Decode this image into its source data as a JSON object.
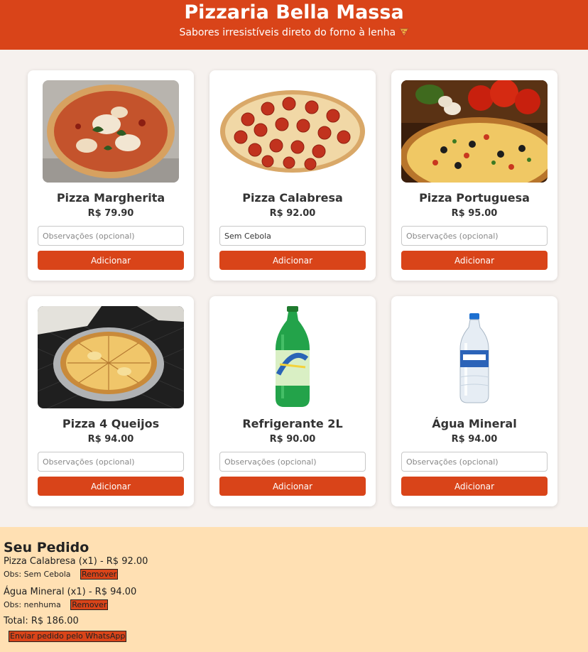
{
  "header": {
    "title": "Pizzaria Bella Massa",
    "subtitle": "Sabores irresistíveis direto do forno à lenha"
  },
  "products": [
    {
      "name": "Pizza Margherita",
      "price": "R$ 79.90",
      "obs_value": "",
      "obs_placeholder": "Observações (opcional)",
      "button": "Adicionar",
      "image": "pizza-margherita-photo"
    },
    {
      "name": "Pizza Calabresa",
      "price": "R$ 92.00",
      "obs_value": "Sem Cebola",
      "obs_placeholder": "Observações (opcional)",
      "button": "Adicionar",
      "image": "pizza-calabresa-photo"
    },
    {
      "name": "Pizza Portuguesa",
      "price": "R$ 95.00",
      "obs_value": "",
      "obs_placeholder": "Observações (opcional)",
      "button": "Adicionar",
      "image": "pizza-portuguesa-photo"
    },
    {
      "name": "Pizza 4 Queijos",
      "price": "R$ 94.00",
      "obs_value": "",
      "obs_placeholder": "Observações (opcional)",
      "button": "Adicionar",
      "image": "pizza-4-queijos-photo"
    },
    {
      "name": "Refrigerante 2L",
      "price": "R$ 90.00",
      "obs_value": "",
      "obs_placeholder": "Observações (opcional)",
      "button": "Adicionar",
      "image": "soda-bottle-photo"
    },
    {
      "name": "Água Mineral",
      "price": "R$ 94.00",
      "obs_value": "",
      "obs_placeholder": "Observações (opcional)",
      "button": "Adicionar",
      "image": "water-bottle-photo"
    }
  ],
  "order": {
    "title": "Seu Pedido",
    "items": [
      {
        "line": "Pizza Calabresa (x1) - R$ 92.00",
        "obs": "Obs: Sem Cebola",
        "remove": "Remover"
      },
      {
        "line": "Água Mineral (x1) - R$ 94.00",
        "obs": "Obs: nenhuma",
        "remove": "Remover"
      }
    ],
    "total": "Total: R$ 186.00",
    "send_button": "Enviar pedido pelo WhatsApp"
  },
  "colors": {
    "accent": "#d94419",
    "page_bg": "#f6f1ee",
    "order_bg": "#ffe0b3"
  }
}
